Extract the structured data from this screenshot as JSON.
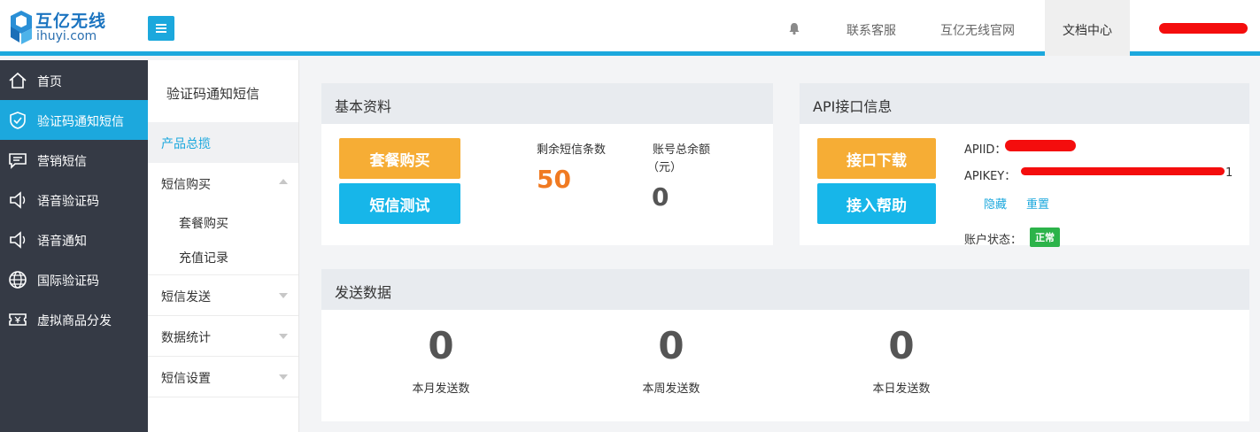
{
  "header": {
    "logo_cn": "互亿无线",
    "logo_en": "ihuyi.com",
    "nav": {
      "support": "联系客服",
      "official_site": "互亿无线官网",
      "docs": "文档中心"
    },
    "colors": {
      "accent": "#1ca8dd",
      "redaction": "#f40d0d"
    }
  },
  "sidebar": {
    "items": [
      {
        "label": "首页",
        "icon": "home-icon"
      },
      {
        "label": "验证码通知短信",
        "icon": "shield-check-icon",
        "active": true
      },
      {
        "label": "营销短信",
        "icon": "message-icon"
      },
      {
        "label": "语音验证码",
        "icon": "speaker-icon"
      },
      {
        "label": "语音通知",
        "icon": "speaker-icon"
      },
      {
        "label": "国际验证码",
        "icon": "globe-icon"
      },
      {
        "label": "虚拟商品分发",
        "icon": "ticket-icon"
      }
    ]
  },
  "subnav": {
    "title": "验证码通知短信",
    "overview": "产品总揽",
    "purchase": "短信购买",
    "purchase_children": [
      "套餐购买",
      "充值记录"
    ],
    "send": "短信发送",
    "stats": "数据统计",
    "settings": "短信设置"
  },
  "basic": {
    "title": "基本资料",
    "buy_button": "套餐购买",
    "test_button": "短信测试",
    "remaining_label": "剩余短信条数",
    "remaining_value": "50",
    "balance_label_1": "账号总余额",
    "balance_label_2": "（元）",
    "balance_value": "0",
    "remaining_color": "#f07a22"
  },
  "api": {
    "title": "API接口信息",
    "download_button": "接口下载",
    "help_button": "接入帮助",
    "apiid_label": "APIID：",
    "apikey_label": "APIKEY：",
    "apikey_tail": "1",
    "hide_link": "隐藏",
    "reset_link": "重置",
    "status_label": "账户状态：",
    "status_badge": "正常"
  },
  "send_data": {
    "title": "发送数据",
    "month_value": "0",
    "month_label": "本月发送数",
    "week_value": "0",
    "week_label": "本周发送数",
    "day_value": "0",
    "day_label": "本日发送数"
  }
}
